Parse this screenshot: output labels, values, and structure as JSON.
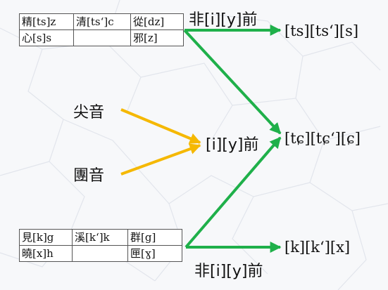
{
  "table_top": {
    "rows": [
      [
        "精[ts]z",
        "清[ts‘]c",
        "從[dz]"
      ],
      [
        "心[s]s",
        "",
        "邪[z]"
      ]
    ]
  },
  "table_bottom": {
    "rows": [
      [
        "見[k]g",
        "溪[k‘]k",
        "群[g]"
      ],
      [
        "曉[x]h",
        "",
        "匣[ɣ]"
      ]
    ]
  },
  "labels": {
    "non_iy_top": "非[i][y]前",
    "non_iy_bottom": "非[i][y]前",
    "iy_front": "[i][y]前",
    "jianyin": "尖音",
    "tuanyin": "團音"
  },
  "results": {
    "dental": "[ts][ts‘][s]",
    "palatal": "[tɕ][tɕ‘][ɕ]",
    "velar": "[k][k‘][x]"
  },
  "colors": {
    "green_arrow": "#1fb04a",
    "yellow_arrow": "#f5b800"
  }
}
